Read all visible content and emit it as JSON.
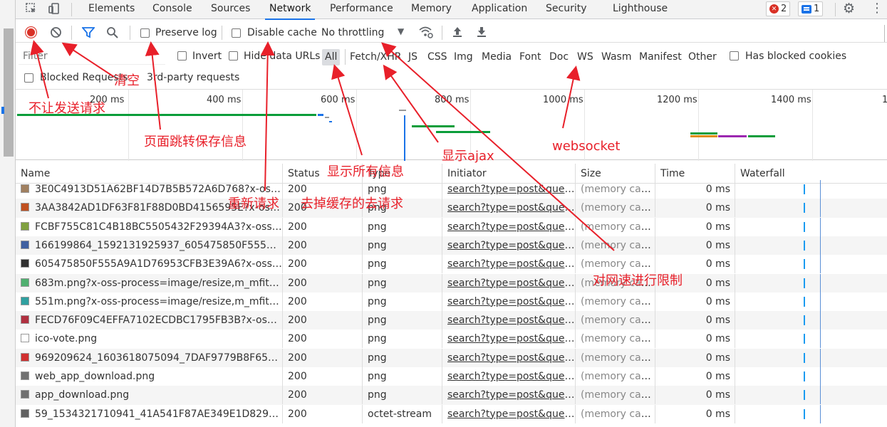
{
  "tabs": {
    "items": [
      "Elements",
      "Console",
      "Sources",
      "Network",
      "Performance",
      "Memory",
      "Application",
      "Security",
      "Lighthouse"
    ],
    "active": "Network"
  },
  "badges": {
    "errors": "2",
    "messages": "1"
  },
  "toolbar": {
    "preserve_log": "Preserve log",
    "disable_cache": "Disable cache",
    "throttling": "No throttling"
  },
  "filter": {
    "placeholder": "Filter",
    "invert": "Invert",
    "hide_data_urls": "Hide data URLs",
    "types": [
      "All",
      "Fetch/XHR",
      "JS",
      "CSS",
      "Img",
      "Media",
      "Font",
      "Doc",
      "WS",
      "Wasm",
      "Manifest",
      "Other"
    ],
    "active_type": "All",
    "has_blocked_cookies": "Has blocked cookies",
    "blocked_requests": "Blocked Requests",
    "third_party": "3rd-party requests"
  },
  "overview": {
    "ticks": [
      "200 ms",
      "400 ms",
      "600 ms",
      "800 ms",
      "1000 ms",
      "1200 ms",
      "1400 ms"
    ]
  },
  "table": {
    "headers": [
      "Name",
      "Status",
      "Type",
      "Initiator",
      "Size",
      "Time",
      "Waterfall"
    ],
    "rows": [
      {
        "name": "3E0C4913D51A62BF14D7B5B572A6D768?x-oss-...",
        "status": "200",
        "type": "png",
        "initiator": "search?type=post&quer...",
        "size": "(memory cac...",
        "time": "0 ms",
        "icon": "#a08060"
      },
      {
        "name": "3AA3842AD1DF63F81F88D0BD4156595E?x-oss-...",
        "status": "200",
        "type": "png",
        "initiator": "search?type=post&quer...",
        "size": "(memory cac...",
        "time": "0 ms",
        "icon": "#c05020"
      },
      {
        "name": "FCBF755C81C4B18BC5505432F29394A3?x-oss-p...",
        "status": "200",
        "type": "png",
        "initiator": "search?type=post&quer...",
        "size": "(memory cac...",
        "time": "0 ms",
        "icon": "#80a040"
      },
      {
        "name": "166199864_1592131925937_605475850F555A9A...",
        "status": "200",
        "type": "png",
        "initiator": "search?type=post&quer...",
        "size": "(memory cac...",
        "time": "0 ms",
        "icon": "#4060a0"
      },
      {
        "name": "605475850F555A9A1D76953CFB3E39A6?x-oss-p...",
        "status": "200",
        "type": "png",
        "initiator": "search?type=post&quer...",
        "size": "(memory cac...",
        "time": "0 ms",
        "icon": "#303030"
      },
      {
        "name": "683m.png?x-oss-process=image/resize,m_mfit,h_...",
        "status": "200",
        "type": "png",
        "initiator": "search?type=post&quer...",
        "size": "(memory cac...",
        "time": "0 ms",
        "icon": "#50b070"
      },
      {
        "name": "551m.png?x-oss-process=image/resize,m_mfit,h_...",
        "status": "200",
        "type": "png",
        "initiator": "search?type=post&quer...",
        "size": "(memory cac...",
        "time": "0 ms",
        "icon": "#30a0a0"
      },
      {
        "name": "FECD76F09C4EFFA7102ECDBC1795FB3B?x-oss-p...",
        "status": "200",
        "type": "png",
        "initiator": "search?type=post&quer...",
        "size": "(memory cac...",
        "time": "0 ms",
        "icon": "#b03040"
      },
      {
        "name": "ico-vote.png",
        "status": "200",
        "type": "png",
        "initiator": "search?type=post&quer...",
        "size": "(memory cac...",
        "time": "0 ms",
        "icon": "#ffffff"
      },
      {
        "name": "969209624_1603618075094_7DAF9779B8F653EF...",
        "status": "200",
        "type": "png",
        "initiator": "search?type=post&quer...",
        "size": "(memory cac...",
        "time": "0 ms",
        "icon": "#d03030"
      },
      {
        "name": "web_app_download.png",
        "status": "200",
        "type": "png",
        "initiator": "search?type=post&quer...",
        "size": "(memory cac...",
        "time": "0 ms",
        "icon": "#707070"
      },
      {
        "name": "app_download.png",
        "status": "200",
        "type": "png",
        "initiator": "search?type=post&quer...",
        "size": "(memory cac...",
        "time": "0 ms",
        "icon": "#707070"
      },
      {
        "name": "59_1534321710941_41A541F87AE349E1D829B1B...",
        "status": "200",
        "type": "octet-stream",
        "initiator": "search?type=post&quer...",
        "size": "(memory cac...",
        "time": "0 ms",
        "icon": "#606060"
      }
    ]
  },
  "annotations": {
    "clear": "清空",
    "no_send": "不让发送请求",
    "preserve": "页面跳转保存信息",
    "rerequest": "重新请求",
    "no_cache": "去掉缓存的去请求",
    "show_all": "显示所有信息",
    "show_ajax": "显示ajax",
    "websocket": "websocket",
    "throttle": "对网速进行限制"
  },
  "colors": {
    "accent": "#1a73e8",
    "record": "#d93025",
    "annotation": "#e8202a"
  }
}
